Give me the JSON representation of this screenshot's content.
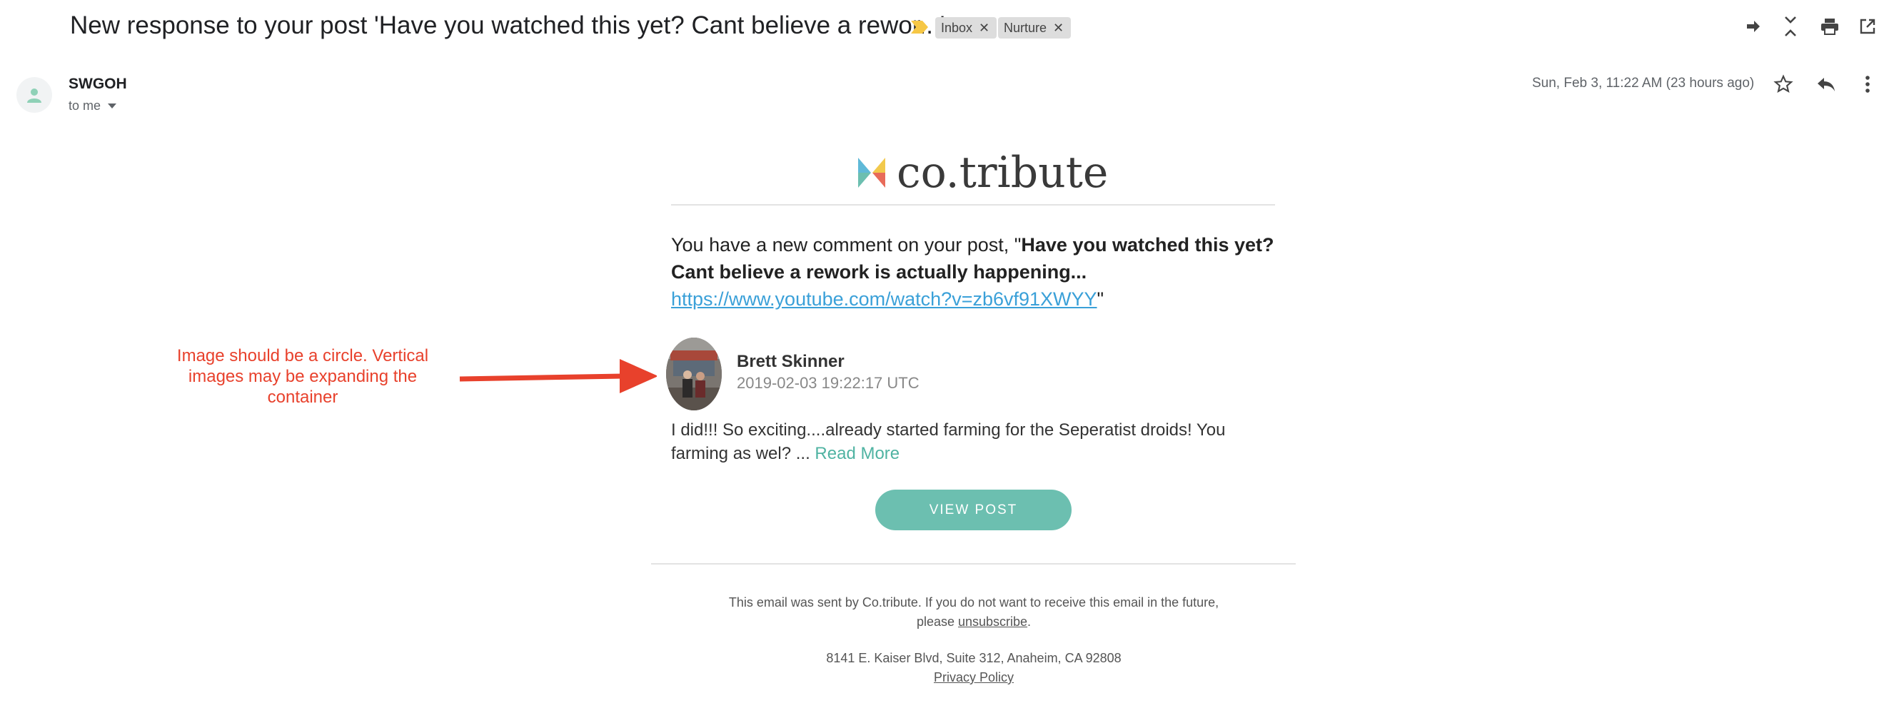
{
  "email": {
    "subject": "New response to your post 'Have you watched this yet? Cant believe a rewor...'",
    "labels": [
      "Inbox",
      "Nurture"
    ],
    "sender": "SWGOH",
    "recipient": "to me",
    "date": "Sun, Feb 3, 11:22 AM (23 hours ago)"
  },
  "toolbar": {
    "icons": [
      "forward-icon",
      "collapse-icon",
      "print-icon",
      "open-new-window-icon",
      "star-icon",
      "reply-icon",
      "more-vert-icon"
    ]
  },
  "body": {
    "logo_text": "co.tribute",
    "intro_prefix": "You have a new comment on your post, \"",
    "post_title": "Have you watched this yet? Cant believe a rework is actually happening...",
    "post_link": "https://www.youtube.com/watch?v=zb6vf91XWYY",
    "intro_suffix": "\"",
    "commenter_name": "Brett Skinner",
    "comment_time": "2019-02-03 19:22:17 UTC",
    "comment_text": "I did!!! So exciting....already started farming for the Seperatist droids! You farming as wel? ... ",
    "read_more": "Read More",
    "view_post_label": "VIEW POST"
  },
  "footer": {
    "line1": "This email was sent by Co.tribute. If you do not want to receive this email in the future,",
    "line2_prefix": "please ",
    "unsubscribe": "unsubscribe",
    "line2_suffix": ".",
    "address": "8141 E. Kaiser Blvd, Suite 312, Anaheim, CA 92808",
    "privacy": "Privacy Policy"
  },
  "annotation": {
    "text": "Image should be a circle. Vertical images may be expanding the container"
  },
  "colors": {
    "accent_teal": "#6cbfb0",
    "link_blue": "#3aa0d8",
    "annotation_red": "#e8412c"
  }
}
